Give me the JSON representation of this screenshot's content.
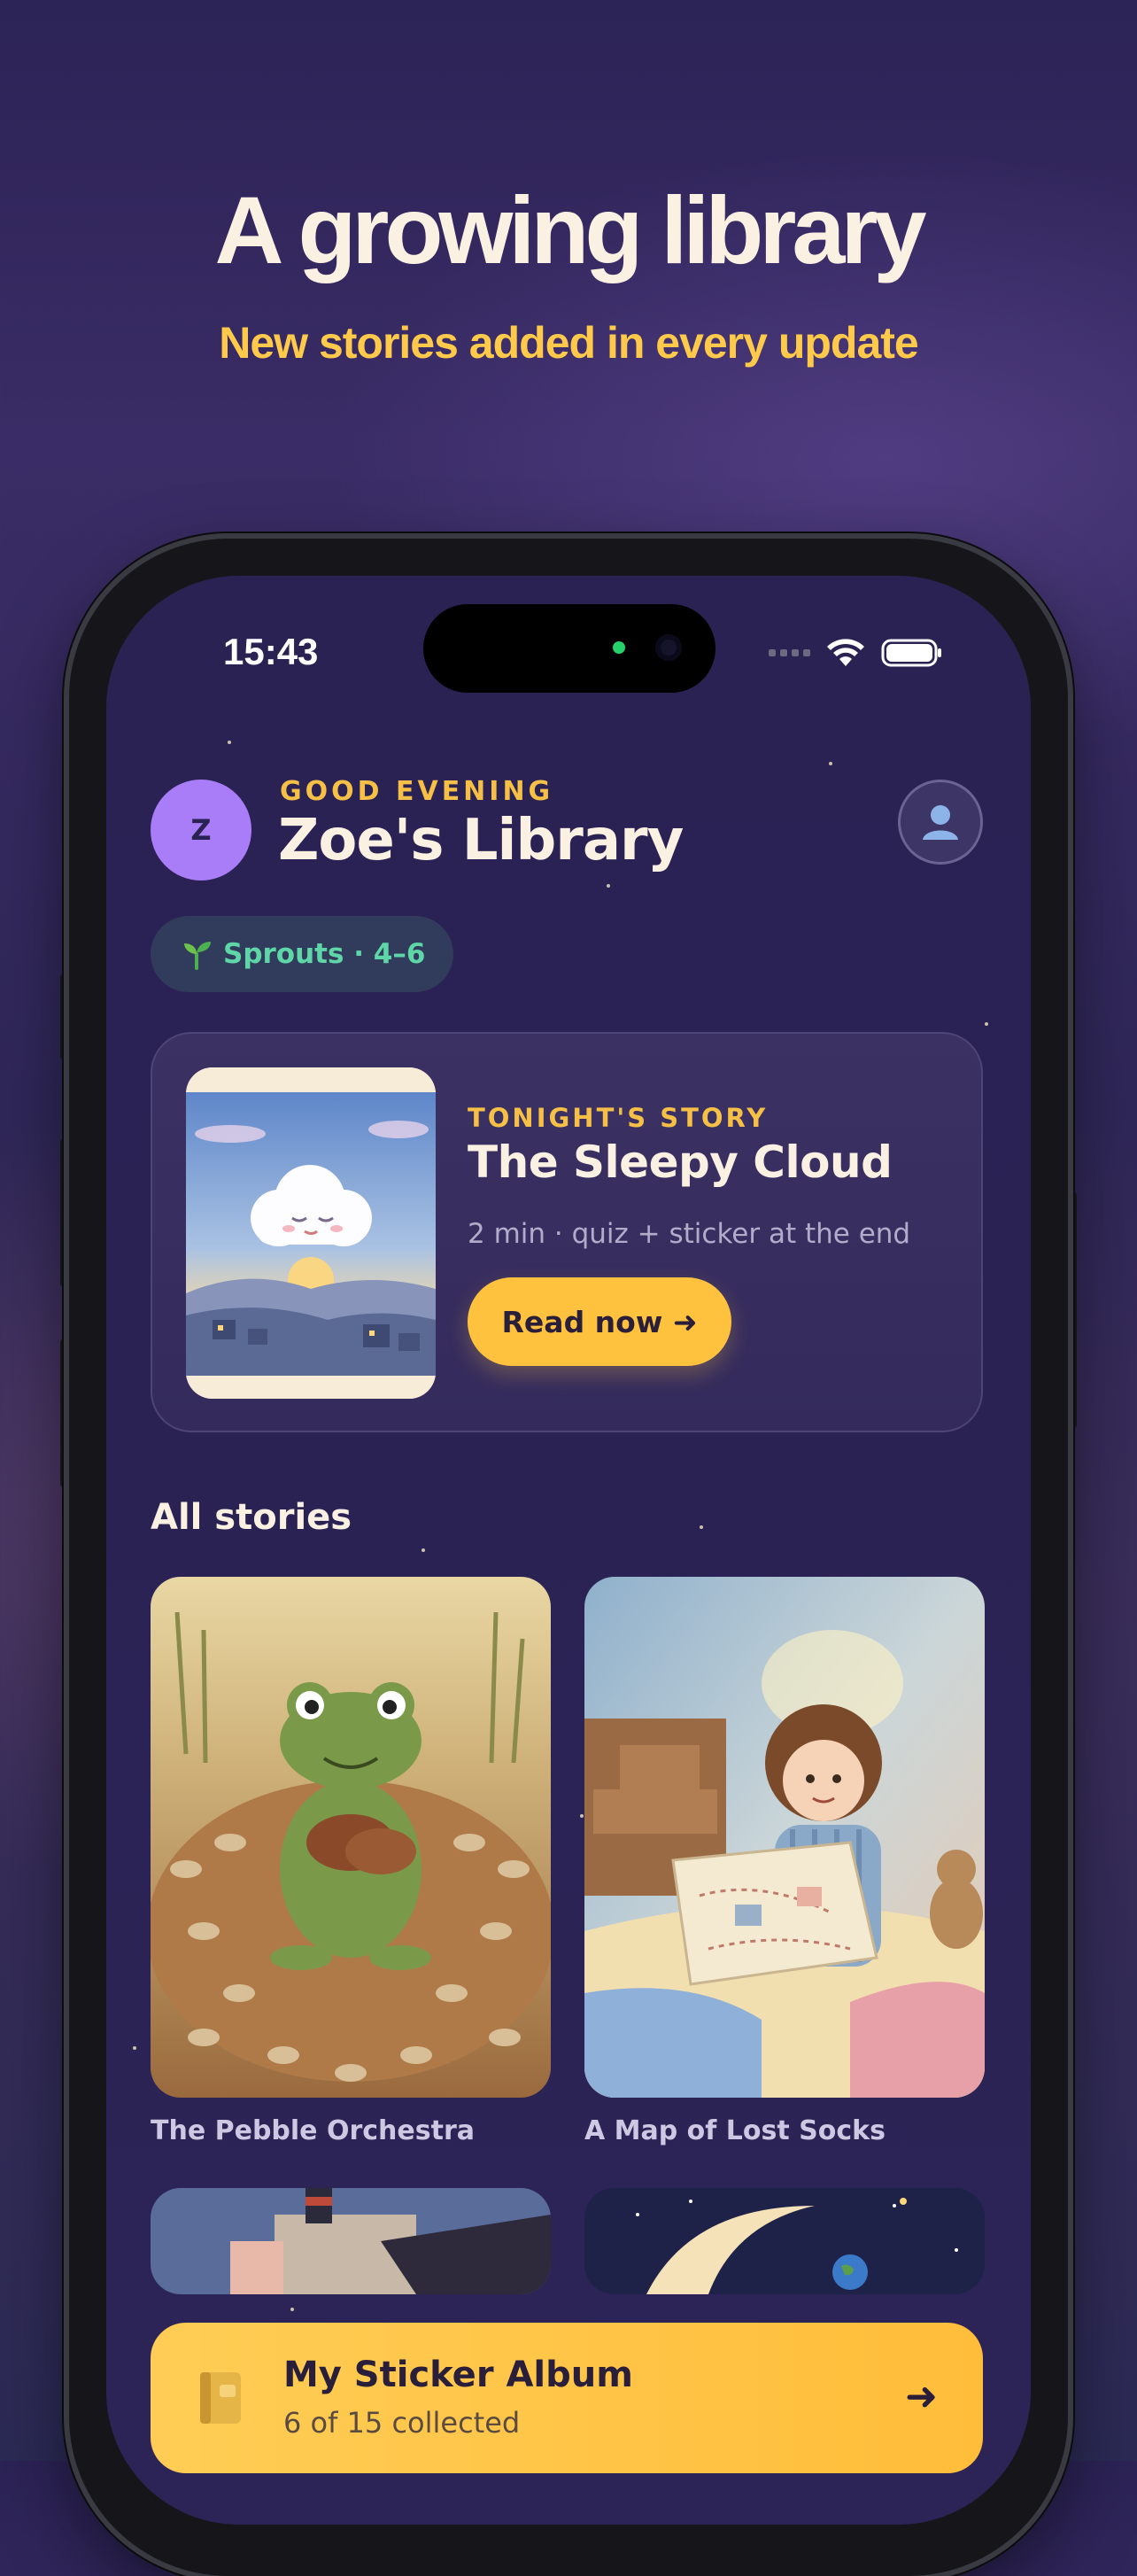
{
  "marketing": {
    "headline": "A growing library",
    "subheadline": "New stories added in every update"
  },
  "status_bar": {
    "time": "15:43"
  },
  "header": {
    "avatar_initial": "Z",
    "greeting": "GOOD EVENING",
    "title": "Zoe's Library"
  },
  "age_group": {
    "icon": "sprout-icon",
    "label": "Sprouts · 4–6"
  },
  "featured": {
    "eyebrow": "TONIGHT'S STORY",
    "title": "The Sleepy Cloud",
    "meta": "2 min · quiz + sticker at the end",
    "button_label": "Read now ➜"
  },
  "all_stories": {
    "title": "All stories",
    "items": [
      {
        "title": "The Pebble Orchestra"
      },
      {
        "title": "A Map of Lost Socks"
      },
      {
        "title": ""
      },
      {
        "title": ""
      }
    ]
  },
  "sticker_album": {
    "title": "My Sticker Album",
    "subtitle": "6 of 15 collected",
    "icon": "book-icon",
    "arrow": "➜"
  },
  "colors": {
    "background": "#2c2356",
    "accent": "#ffc23e",
    "avatar": "#a97df8",
    "pill_text": "#5fd6a8"
  }
}
